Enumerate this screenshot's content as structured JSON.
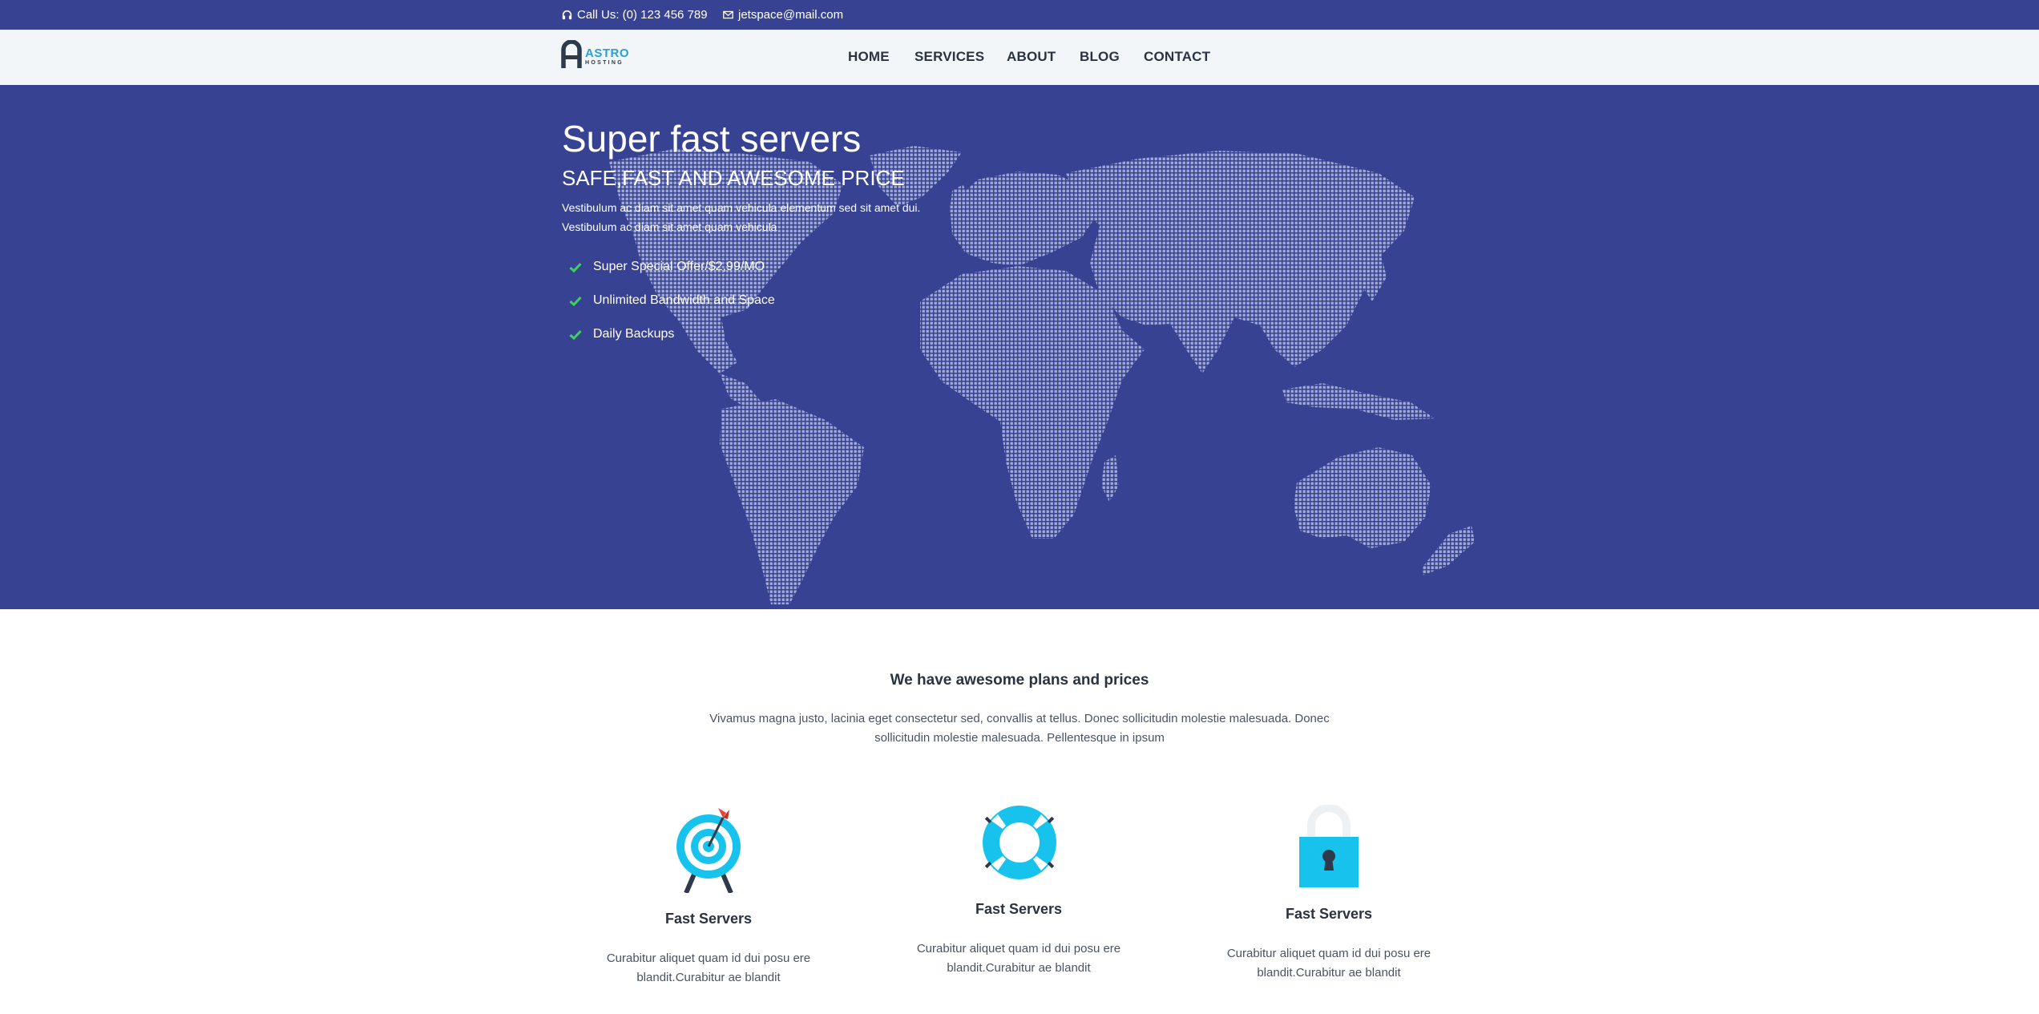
{
  "topbar": {
    "phone": "Call Us: (0) 123 456 789",
    "email": "jetspace@mail.com",
    "phone_icon": "headphones-icon",
    "email_icon": "envelope-icon"
  },
  "logo": {
    "name": "ASTRO",
    "tagline": "HOSTING"
  },
  "nav": {
    "items": [
      "HOME",
      "SERVICES",
      "ABOUT",
      "BLOG",
      "CONTACT"
    ]
  },
  "hero": {
    "title": "Super fast servers",
    "subtitle": "SAFE,FAST AND AWESOME PRICE",
    "desc_line1": "Vestibulum ac diam sit amet quam vehicula elementum sed sit amet dui.",
    "desc_line2": "Vestibulum ac diam sit amet quam vehicula",
    "features": [
      "Super Special Offer/$2,99/MO",
      "Unlimited Bandwidth and Space",
      "Daily Backups"
    ],
    "feature_icon": "check-icon",
    "background_image": "world-map-dots"
  },
  "plans": {
    "title": "We have awesome plans and prices",
    "desc": "Vivamus magna justo, lacinia eget consectetur sed, convallis at tellus. Donec sollicitudin molestie malesuada. Donec sollicitudin molestie malesuada. Pellentesque in ipsum",
    "cards": [
      {
        "icon": "target-icon",
        "title": "Fast Servers",
        "text": "Curabitur aliquet quam id dui posu ere blandit.Curabitur ae blandit"
      },
      {
        "icon": "lifebuoy-icon",
        "title": "Fast Servers",
        "text": "Curabitur aliquet quam id dui posu ere blandit.Curabitur ae blandit"
      },
      {
        "icon": "padlock-icon",
        "title": "Fast Servers",
        "text": "Curabitur aliquet quam id dui posu ere blandit.Curabitur ae blandit"
      }
    ]
  },
  "colors": {
    "topbar": "#374392",
    "header": "#f3f6f8",
    "hero": "#374392",
    "check": "#3ad45a",
    "accent": "#17c3ec",
    "logo_blue": "#2a9fd6"
  }
}
